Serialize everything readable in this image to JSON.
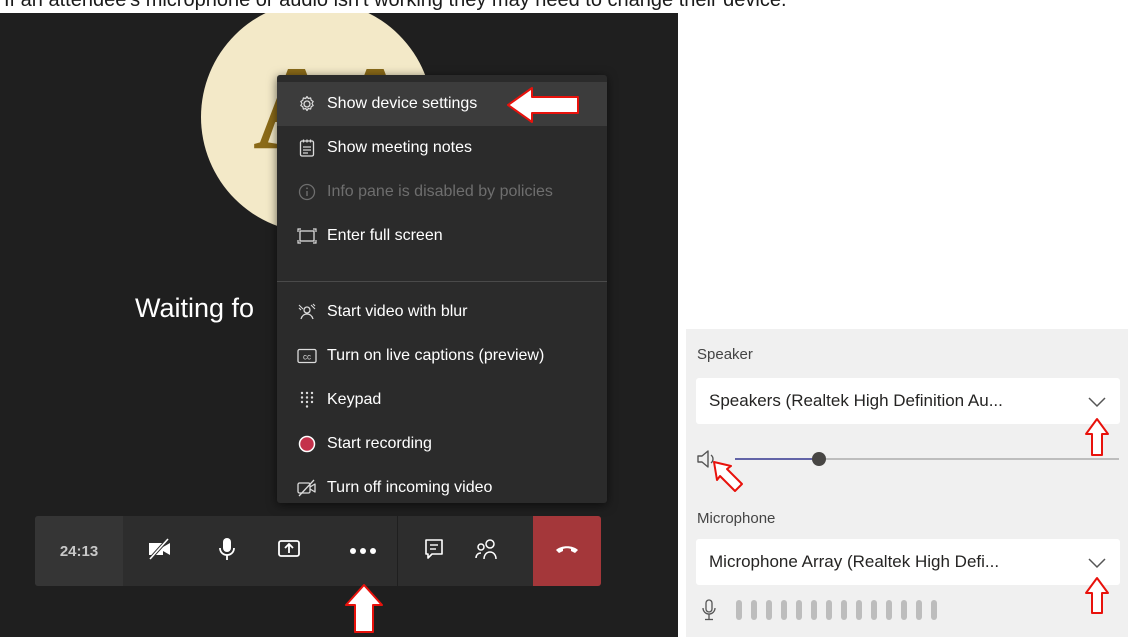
{
  "caption": "If an attendee's microphone or audio isn't working they may need to change their device.",
  "meeting": {
    "avatar_initials": "AA",
    "waiting_text": "Waiting fo",
    "menu": {
      "items": [
        {
          "label": "Show device settings",
          "icon": "gear-icon"
        },
        {
          "label": "Show meeting notes",
          "icon": "notes-icon"
        },
        {
          "label": "Info pane is disabled by policies",
          "icon": "info-icon"
        },
        {
          "label": "Enter full screen",
          "icon": "fullscreen-icon"
        },
        {
          "label": "Start video with blur",
          "icon": "blur-icon"
        },
        {
          "label": "Turn on live captions (preview)",
          "icon": "cc-icon"
        },
        {
          "label": "Keypad",
          "icon": "keypad-icon"
        },
        {
          "label": "Start recording",
          "icon": "record-icon"
        },
        {
          "label": "Turn off incoming video",
          "icon": "video-off-icon"
        }
      ]
    },
    "toolbar": {
      "timer": "24:13"
    }
  },
  "devices": {
    "speaker_label": "Speaker",
    "speaker_value": "Speakers (Realtek High Definition Au...",
    "speaker_volume": 0.22,
    "microphone_label": "Microphone",
    "microphone_value": "Microphone Array (Realtek High Defi...",
    "mic_level_bars": 14
  },
  "colors": {
    "hangup": "#a4373a",
    "accent": "#6264a7",
    "annotation_arrow": "#e8120c",
    "menu_bg": "#2b2b2b",
    "meeting_bg": "#1f1f1f"
  }
}
